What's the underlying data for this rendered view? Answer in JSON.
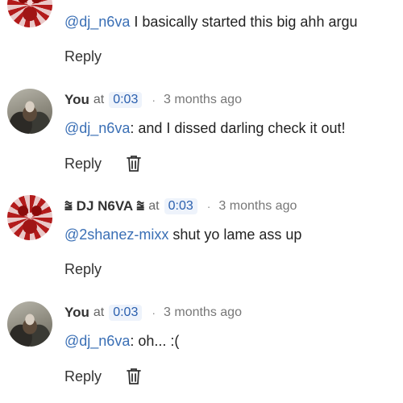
{
  "comments": [
    {
      "avatar": "red-dj-avatar",
      "author": "",
      "mention": "@dj_n6va",
      "text": " I basically started this big ahh argu",
      "reply_label": "Reply",
      "deletable": false
    },
    {
      "avatar": "gray-you-avatar",
      "author": "You",
      "at": "at",
      "timestamp": "0:03",
      "dot": "·",
      "ago": "3 months ago",
      "mention": "@dj_n6va",
      "text": ": and I dissed darling check it out!",
      "reply_label": "Reply",
      "deletable": true
    },
    {
      "avatar": "red-dj-avatar",
      "author": "⩰ DJ N6VA ⩰",
      "at": "at",
      "timestamp": "0:03",
      "dot": "·",
      "ago": "3 months ago",
      "mention": "@2shanez-mixx",
      "text": " shut yo lame ass up",
      "reply_label": "Reply",
      "deletable": false
    },
    {
      "avatar": "gray-you-avatar",
      "author": "You",
      "at": "at",
      "timestamp": "0:03",
      "dot": "·",
      "ago": "3 months ago",
      "mention": "@dj_n6va",
      "text": ": oh... :(",
      "reply_label": "Reply",
      "deletable": true
    }
  ],
  "colors": {
    "mention": "#3a6fb5",
    "timestamp": "#2a5fae",
    "timestamp_bg": "#eef3fb"
  },
  "icons": {
    "delete": "trash-icon"
  }
}
